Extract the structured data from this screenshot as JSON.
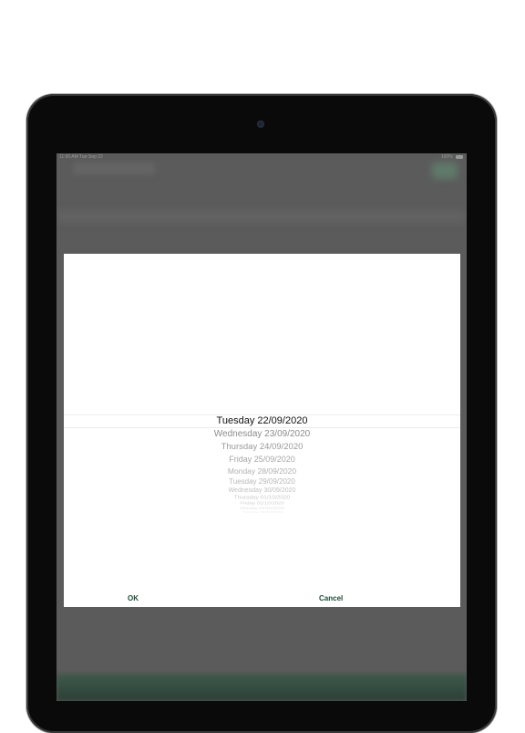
{
  "status_bar": {
    "time_date": "11:00 AM  Tue Sep 22",
    "battery": "100%"
  },
  "picker": {
    "selected": "Tuesday 22/09/2020",
    "items": [
      "Wednesday 23/09/2020",
      "Thursday 24/09/2020",
      "Friday 25/09/2020",
      "Monday 28/09/2020",
      "Tuesday 29/09/2020",
      "Wednesday 30/09/2020",
      "Thursday 01/10/2020",
      "Friday 02/10/2020",
      "Monday 05/10/2020",
      "Tuesday 06/10/2020"
    ]
  },
  "buttons": {
    "ok": "OK",
    "cancel": "Cancel"
  },
  "colors": {
    "accent": "#1d4c36",
    "overlay": "#5b5b5b"
  }
}
